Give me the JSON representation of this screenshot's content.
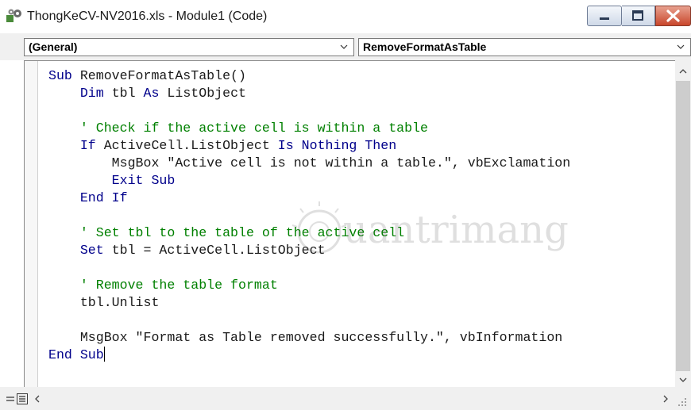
{
  "window": {
    "title": "ThongKeCV-NV2016.xls - Module1 (Code)"
  },
  "dropdowns": {
    "object": "(General)",
    "procedure": "RemoveFormatAsTable"
  },
  "code_lines": [
    [
      {
        "t": "Sub ",
        "c": "kw"
      },
      {
        "t": "RemoveFormatAsTable()",
        "c": ""
      }
    ],
    [
      {
        "t": "    ",
        "c": ""
      },
      {
        "t": "Dim ",
        "c": "kw"
      },
      {
        "t": "tbl ",
        "c": ""
      },
      {
        "t": "As ",
        "c": "kw"
      },
      {
        "t": "ListObject",
        "c": ""
      }
    ],
    [],
    [
      {
        "t": "    ' Check if the active cell is within a table",
        "c": "cm"
      }
    ],
    [
      {
        "t": "    ",
        "c": ""
      },
      {
        "t": "If ",
        "c": "kw"
      },
      {
        "t": "ActiveCell.ListObject ",
        "c": ""
      },
      {
        "t": "Is ",
        "c": "kw"
      },
      {
        "t": "Nothing ",
        "c": "kw"
      },
      {
        "t": "Then",
        "c": "kw"
      }
    ],
    [
      {
        "t": "        MsgBox \"Active cell is not within a table.\", vbExclamation",
        "c": ""
      }
    ],
    [
      {
        "t": "        ",
        "c": ""
      },
      {
        "t": "Exit Sub",
        "c": "kw"
      }
    ],
    [
      {
        "t": "    ",
        "c": ""
      },
      {
        "t": "End If",
        "c": "kw"
      }
    ],
    [],
    [
      {
        "t": "    ' Set tbl to the table of the active cell",
        "c": "cm"
      }
    ],
    [
      {
        "t": "    ",
        "c": ""
      },
      {
        "t": "Set ",
        "c": "kw"
      },
      {
        "t": "tbl = ActiveCell.ListObject",
        "c": ""
      }
    ],
    [],
    [
      {
        "t": "    ' Remove the table format",
        "c": "cm"
      }
    ],
    [
      {
        "t": "    tbl.Unlist",
        "c": ""
      }
    ],
    [],
    [
      {
        "t": "    MsgBox \"Format as Table removed successfully.\", vbInformation",
        "c": ""
      }
    ],
    [
      {
        "t": "End Sub",
        "c": "kw"
      },
      {
        "t": "",
        "c": "cursor"
      }
    ]
  ],
  "watermark": {
    "text": "uantrimang"
  },
  "colors": {
    "keyword": "#00008b",
    "comment": "#008000",
    "close_button": "#c9462b"
  },
  "icons": {
    "app": "vba-project-icon",
    "minimize": "minimize-icon",
    "maximize": "maximize-icon",
    "close": "close-icon"
  }
}
